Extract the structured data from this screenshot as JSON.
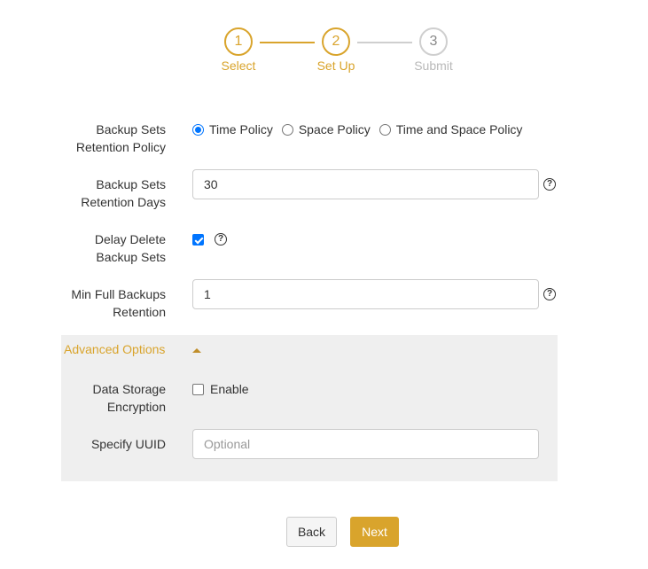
{
  "stepper": {
    "steps": [
      {
        "number": "1",
        "label": "Select",
        "state": "complete"
      },
      {
        "number": "2",
        "label": "Set Up",
        "state": "active"
      },
      {
        "number": "3",
        "label": "Submit",
        "state": "pending"
      }
    ]
  },
  "form": {
    "retention_policy": {
      "label_line1": "Backup Sets",
      "label_line2": "Retention Policy",
      "options": [
        "Time Policy",
        "Space Policy",
        "Time and Space Policy"
      ],
      "selected": "Time Policy"
    },
    "retention_days": {
      "label_line1": "Backup Sets",
      "label_line2": "Retention Days",
      "value": "30"
    },
    "delay_delete": {
      "label_line1": "Delay Delete",
      "label_line2": "Backup Sets",
      "checked": true
    },
    "min_full": {
      "label_line1": "Min Full Backups",
      "label_line2": "Retention",
      "value": "1"
    },
    "help_glyph": "?"
  },
  "advanced": {
    "title": "Advanced Options",
    "expanded": true,
    "encryption": {
      "label_line1": "Data Storage",
      "label_line2": "Encryption",
      "option_label": "Enable",
      "checked": false
    },
    "uuid": {
      "label": "Specify UUID",
      "placeholder": "Optional",
      "value": ""
    }
  },
  "actions": {
    "back_label": "Back",
    "next_label": "Next"
  },
  "colors": {
    "accent": "#d9a42c",
    "inactive": "#cfcfcf",
    "panel_bg": "#efefef",
    "radio_blue": "#0075ff"
  }
}
